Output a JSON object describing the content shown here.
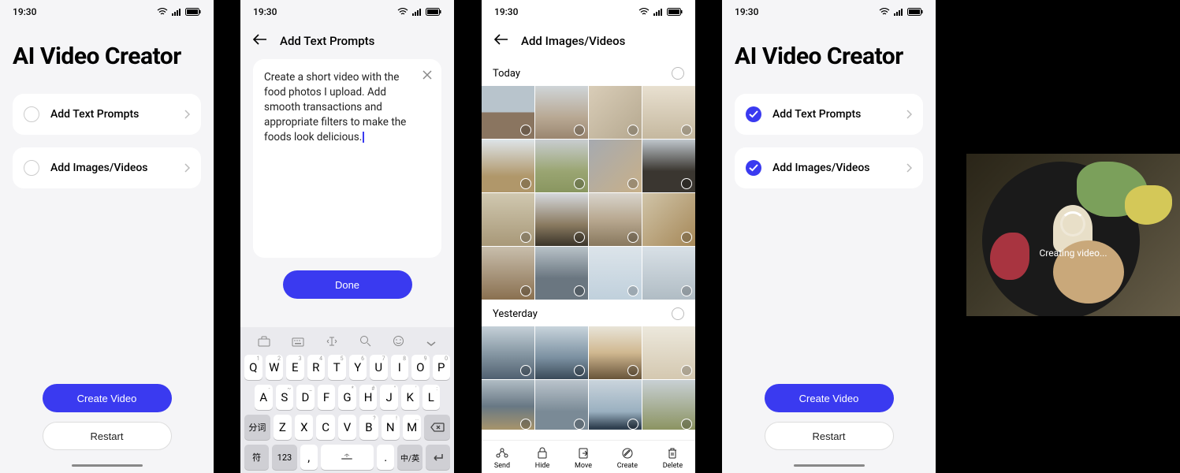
{
  "status": {
    "time": "19:30"
  },
  "screen1": {
    "title": "AI Video Creator",
    "opt1": "Add Text Prompts",
    "opt2": "Add Images/Videos",
    "create": "Create Video",
    "restart": "Restart"
  },
  "screen2": {
    "header": "Add Text Prompts",
    "prompt_text": "Create a short video with the food photos I upload. Add smooth transactions and appropriate filters to make the foods look delicious.",
    "done": "Done",
    "keys_r1": [
      "Q",
      "W",
      "E",
      "R",
      "T",
      "Y",
      "U",
      "I",
      "O",
      "P"
    ],
    "keys_r1_sup": [
      "1",
      "2",
      "3",
      "4",
      "5",
      "6",
      "7",
      "8",
      "9",
      "0"
    ],
    "keys_r2": [
      "A",
      "S",
      "D",
      "F",
      "G",
      "H",
      "J",
      "K",
      "L"
    ],
    "keys_r2_sup": [
      "-",
      "~",
      "_",
      "",
      "*",
      "#",
      "\"",
      "'",
      ":"
    ],
    "keys_r3_shift": "分词",
    "keys_r3": [
      "Z",
      "X",
      "C",
      "V",
      "B",
      "N",
      "M"
    ],
    "keys_r3_sup": [
      "",
      "",
      "",
      "",
      "?",
      "!",
      "…"
    ],
    "keys_r4": {
      "sym": "符",
      "num": "123",
      "comma": ",",
      "period": ".",
      "lang": "中/英"
    }
  },
  "screen3": {
    "header": "Add Images/Videos",
    "section1": "Today",
    "section2": "Yesterday",
    "toolbar": {
      "send": "Send",
      "hide": "Hide",
      "move": "Move",
      "create": "Create",
      "delete": "Delete"
    }
  },
  "screen4": {
    "title": "AI Video Creator",
    "opt1": "Add Text Prompts",
    "opt2": "Add Images/Videos",
    "create": "Create Video",
    "restart": "Restart"
  },
  "screen5": {
    "loading": "Creating video..."
  }
}
